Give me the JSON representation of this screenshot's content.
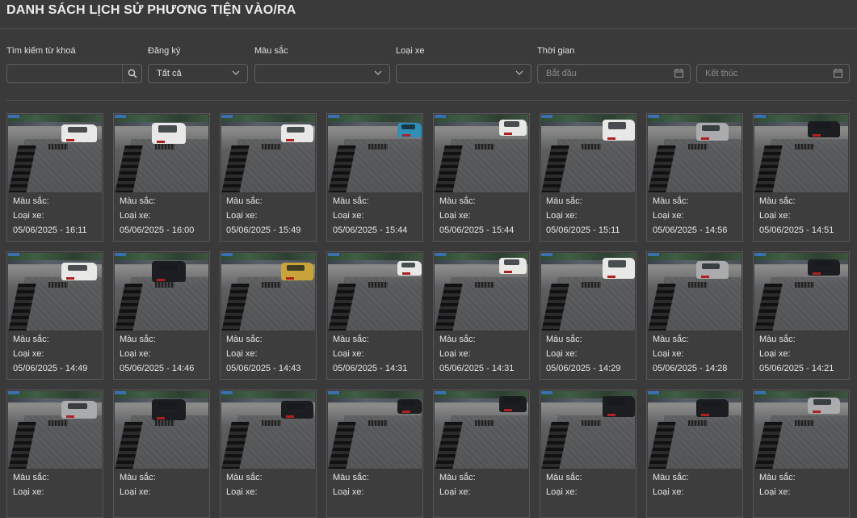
{
  "page": {
    "title": "DANH SÁCH LỊCH SỬ PHƯƠNG TIỆN VÀO/RA"
  },
  "filters": {
    "keyword": {
      "label": "Tìm kiếm từ khoá",
      "value": ""
    },
    "registration": {
      "label": "Đăng ký",
      "value": "Tất cả"
    },
    "color": {
      "label": "Màu sắc",
      "value": ""
    },
    "vehicle_type": {
      "label": "Loại xe",
      "value": ""
    },
    "time": {
      "label": "Thời gian",
      "start_placeholder": "Bắt đầu",
      "end_placeholder": "Kết thúc"
    }
  },
  "card_labels": {
    "color": "Màu sắc:",
    "type": "Loại xe:"
  },
  "records": [
    {
      "time": "05/06/2025 - 16:11",
      "car": "white"
    },
    {
      "time": "05/06/2025 - 16:00",
      "car": "white"
    },
    {
      "time": "05/06/2025 - 15:49",
      "car": "white"
    },
    {
      "time": "05/06/2025 - 15:44",
      "car": "blue"
    },
    {
      "time": "05/06/2025 - 15:44",
      "car": "white"
    },
    {
      "time": "05/06/2025 - 15:11",
      "car": "white"
    },
    {
      "time": "05/06/2025 - 14:56",
      "car": "silver"
    },
    {
      "time": "05/06/2025 - 14:51",
      "car": "black"
    },
    {
      "time": "05/06/2025 - 14:49",
      "car": "white"
    },
    {
      "time": "05/06/2025 - 14:46",
      "car": "black"
    },
    {
      "time": "05/06/2025 - 14:43",
      "car": "yellow"
    },
    {
      "time": "05/06/2025 - 14:31",
      "car": "white"
    },
    {
      "time": "05/06/2025 - 14:31",
      "car": "white"
    },
    {
      "time": "05/06/2025 - 14:29",
      "car": "white"
    },
    {
      "time": "05/06/2025 - 14:28",
      "car": "silver"
    },
    {
      "time": "05/06/2025 - 14:21",
      "car": "black"
    },
    {
      "time": "",
      "car": "silver"
    },
    {
      "time": "",
      "car": "black"
    },
    {
      "time": "",
      "car": "black"
    },
    {
      "time": "",
      "car": "black"
    },
    {
      "time": "",
      "car": "black"
    },
    {
      "time": "",
      "car": "black"
    },
    {
      "time": "",
      "car": "black"
    },
    {
      "time": "",
      "car": "silver"
    }
  ],
  "colors": {
    "background": "#3a3a3a",
    "card_border": "#565656",
    "text": "#e6e6e6"
  }
}
